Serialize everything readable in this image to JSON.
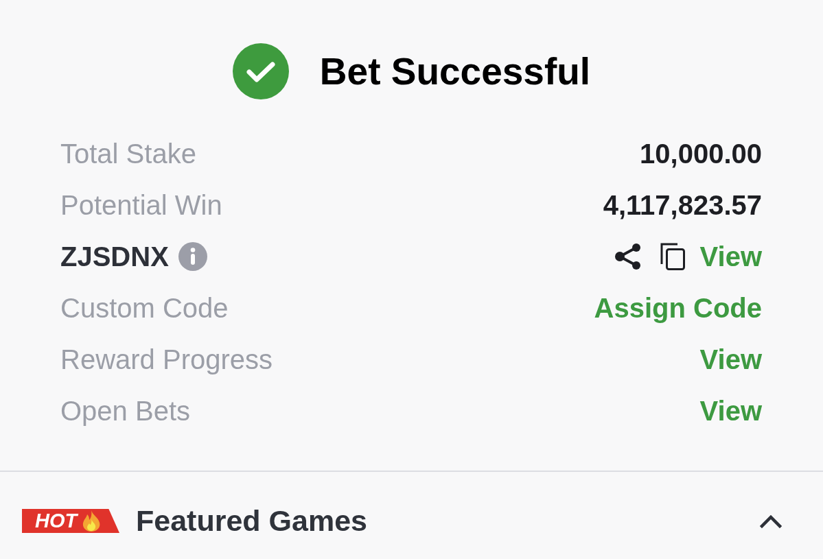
{
  "header": {
    "title": "Bet Successful"
  },
  "summary": {
    "rows": [
      {
        "kind": "value",
        "label": "Total Stake",
        "value": "10,000.00"
      },
      {
        "kind": "value",
        "label": "Potential Win",
        "value": "4,117,823.57"
      },
      {
        "kind": "code",
        "label": "ZJSDNX",
        "link": "View"
      },
      {
        "kind": "link",
        "label": "Custom Code",
        "link": "Assign Code"
      },
      {
        "kind": "link",
        "label": "Reward Progress",
        "link": "View"
      },
      {
        "kind": "link",
        "label": "Open Bets",
        "link": "View"
      }
    ]
  },
  "featured": {
    "badge": "HOT",
    "title": "Featured Games",
    "expanded": true
  }
}
